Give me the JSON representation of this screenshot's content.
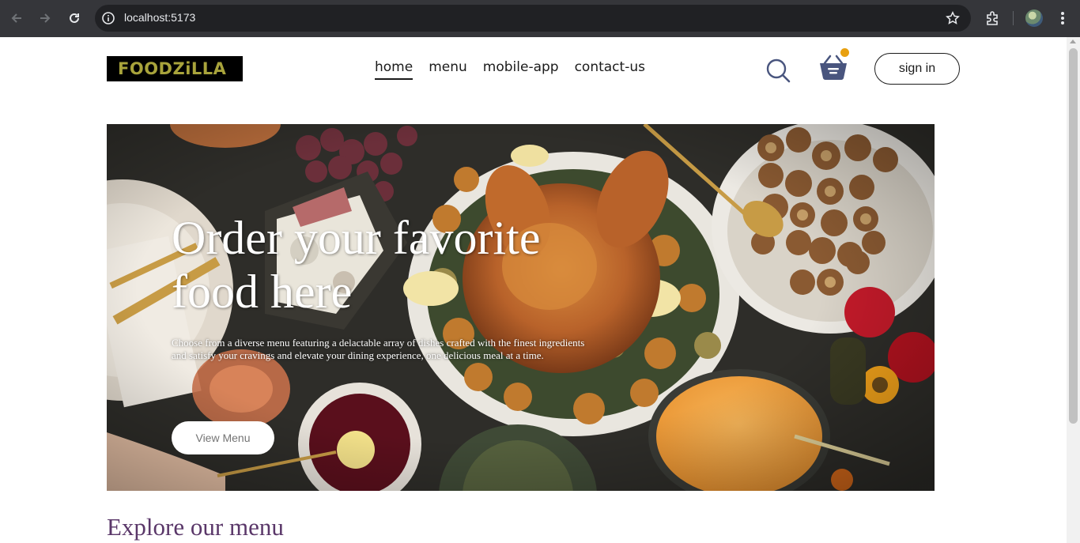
{
  "browser": {
    "url": "localhost:5173",
    "icons": [
      "back-icon",
      "forward-icon",
      "reload-icon",
      "site-info-icon",
      "bookmark-star-icon",
      "extensions-icon",
      "profile-avatar",
      "chrome-menu-icon"
    ]
  },
  "header": {
    "logo": "FOODZiLLA",
    "nav": [
      "home",
      "menu",
      "mobile-app",
      "contact-us"
    ],
    "active_nav": "home",
    "sign_in": "sign in",
    "colors": {
      "logo_bg": "#000000",
      "logo_text": "#a8a33b",
      "cart_dot": "#e8a010"
    }
  },
  "hero": {
    "title": "Order your favorite food here",
    "description": "Choose from a diverse menu featuring a delactable array of dishes crafted with the finest ingredients and satisfy your cravings and elevate your dining experience, one delicious meal at a time.",
    "button": "View Menu"
  },
  "section": {
    "heading": "Explore our menu",
    "heading_color": "#5a3769"
  }
}
